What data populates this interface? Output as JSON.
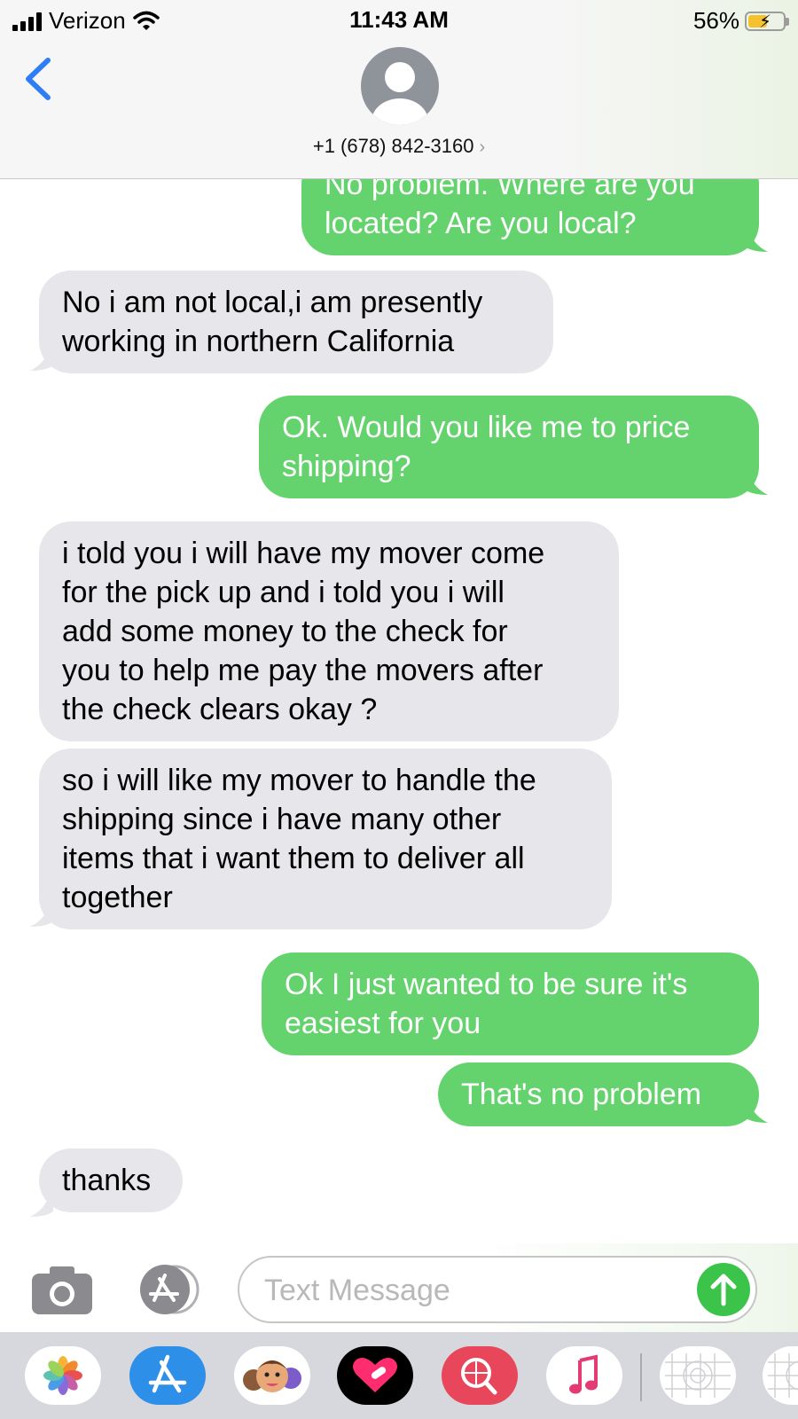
{
  "status_bar": {
    "carrier": "Verizon",
    "time": "11:43 AM",
    "battery_percent": "56%",
    "battery_level": 0.56,
    "battery_color": "#f6c12f",
    "charging": true
  },
  "header": {
    "contact": "+1 (678) 842-3160",
    "contact_chevron": "›",
    "back_icon": "chevron-left-icon",
    "avatar_icon": "person-silhouette-icon"
  },
  "messages": [
    {
      "direction": "outgoing",
      "text": "No problem. Where are you\nlocated? Are you local?"
    },
    {
      "direction": "incoming",
      "text": "No i am not local,i am presently\nworking in northern California"
    },
    {
      "direction": "outgoing",
      "text": "Ok. Would you like me to price\nshipping?"
    },
    {
      "direction": "incoming",
      "text": "i told you i will have my mover come\nfor the pick up and i told you i will\nadd some money to the check for\nyou to help me pay the movers after\nthe check clears okay  ?"
    },
    {
      "direction": "incoming",
      "text": "so i will like my mover to handle the\nshipping since i have many other\nitems that i want them to deliver all\ntogether"
    },
    {
      "direction": "outgoing",
      "text": "Ok I just wanted to be sure it's\neasiest for you"
    },
    {
      "direction": "outgoing",
      "text": "That's no problem"
    },
    {
      "direction": "incoming",
      "text": "thanks"
    }
  ],
  "composer": {
    "placeholder": "Text Message",
    "camera_icon": "camera-icon",
    "apps_icon": "app-store-icon",
    "send_icon": "arrow-up-icon"
  },
  "app_drawer": [
    {
      "name": "photos-app-icon"
    },
    {
      "name": "app-store-app-icon"
    },
    {
      "name": "memoji-app-icon"
    },
    {
      "name": "digital-touch-app-icon"
    },
    {
      "name": "web-images-search-app-icon"
    },
    {
      "name": "music-app-icon"
    },
    {
      "name": "sticker-app-icon"
    },
    {
      "name": "sticker-app-icon-2"
    }
  ],
  "colors": {
    "outgoing_bubble": "#65d36d",
    "incoming_bubble": "#e6e6eb",
    "ios_blue": "#2f7df6",
    "send_button": "#3cc34a"
  }
}
